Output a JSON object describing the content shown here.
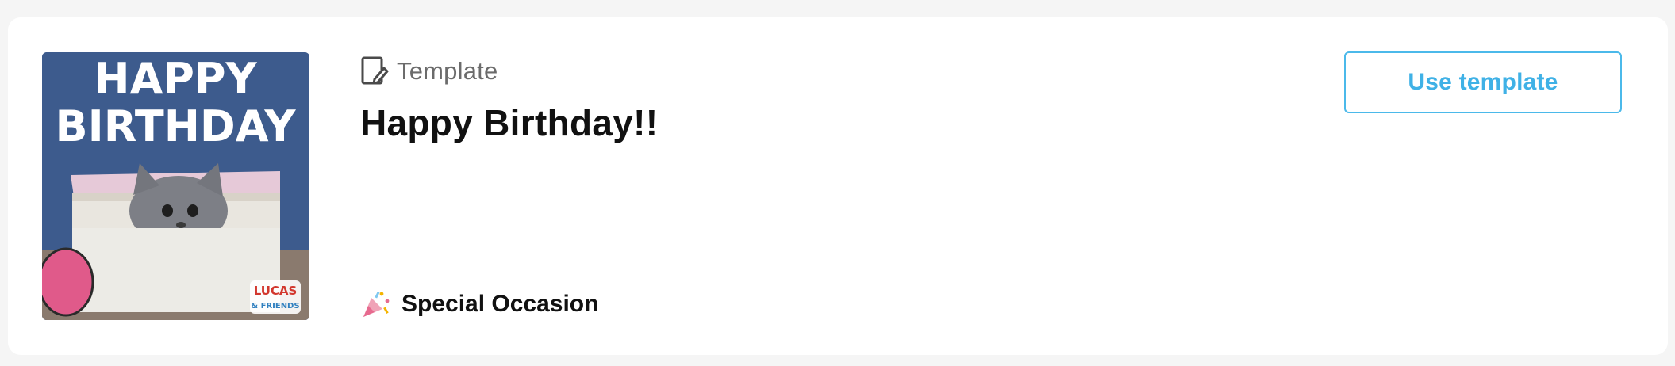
{
  "card": {
    "thumbnail": {
      "alt_semantic": "happy-birthday-kitten-gif",
      "text_line1": "HAPPY",
      "text_line2": "BIRTHDAY",
      "logo_text_1": "LUCAS",
      "logo_text_2": "& FRIENDS"
    },
    "type_icon": "template-edit-icon",
    "type_label": "Template",
    "title": "Happy Birthday!!",
    "category_icon": "party-popper-icon",
    "category_label": "Special Occasion",
    "action_label": "Use template"
  },
  "colors": {
    "accent": "#4bb9ea",
    "title": "#111111",
    "muted": "#6b6b6b",
    "background": "#f5f5f5",
    "card": "#ffffff"
  }
}
